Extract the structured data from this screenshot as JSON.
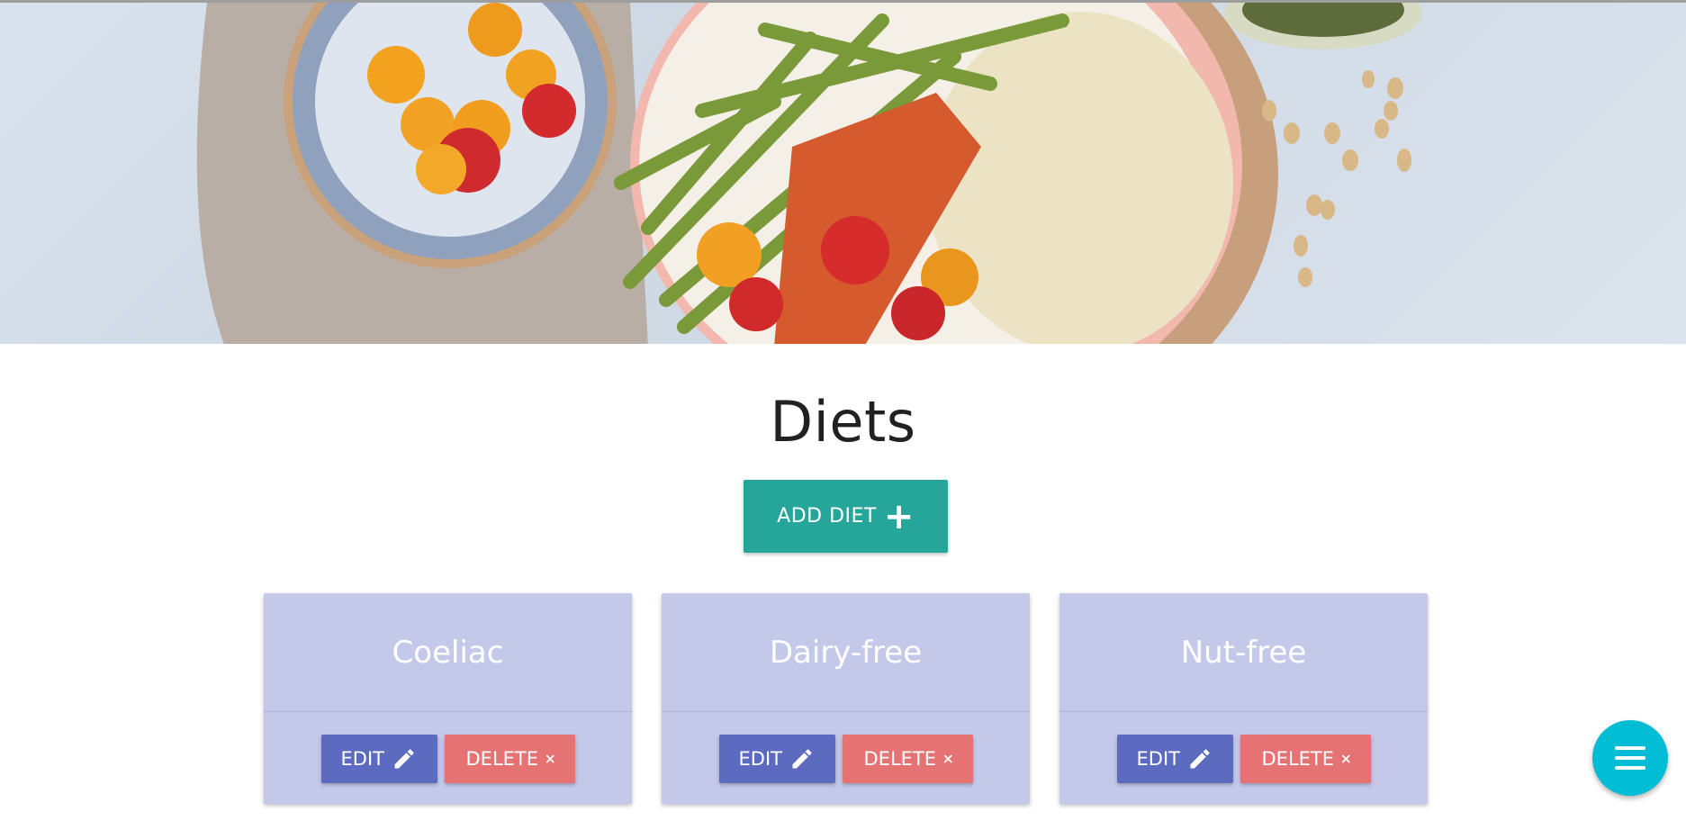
{
  "page": {
    "title": "Diets"
  },
  "toolbar": {
    "add_label": "ADD DIET"
  },
  "diets": [
    {
      "name": "Coeliac",
      "edit_label": "EDIT",
      "delete_label": "DELETE"
    },
    {
      "name": "Dairy-free",
      "edit_label": "EDIT",
      "delete_label": "DELETE"
    },
    {
      "name": "Nut-free",
      "edit_label": "EDIT",
      "delete_label": "DELETE"
    }
  ],
  "icons": {
    "add": "plus-icon",
    "edit": "pencil-icon",
    "delete": "close-icon",
    "menu": "menu-icon"
  },
  "colors": {
    "add_button": "#26a69a",
    "card_background": "#c5c9e9",
    "edit_button": "#5c6bc0",
    "delete_button": "#e57373",
    "fab": "#00bcd4"
  }
}
